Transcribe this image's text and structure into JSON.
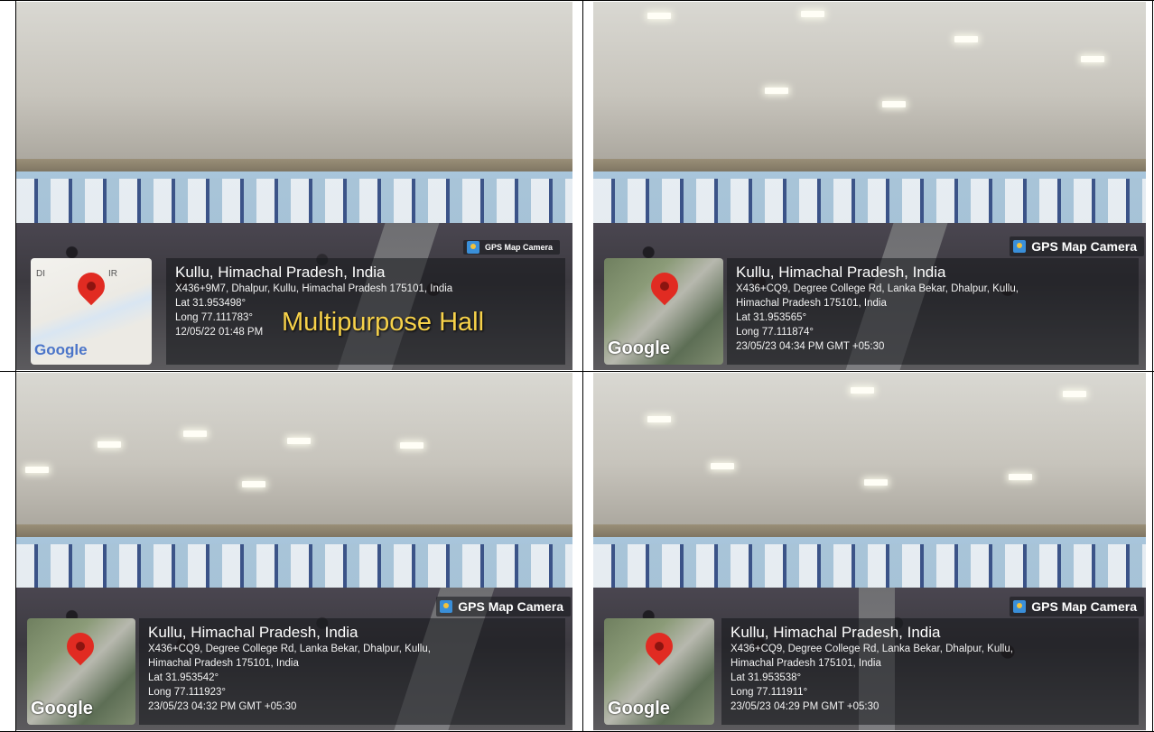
{
  "photos": [
    {
      "badge": "GPS Map Camera",
      "title": "Kullu, Himachal Pradesh, India",
      "address": "X436+9M7, Dhalpur, Kullu, Himachal Pradesh 175101, India",
      "lat": "Lat 31.953498°",
      "long": "Long 77.111783°",
      "timestamp": "12/05/22 01:48 PM",
      "caption": "Multipurpose Hall",
      "map_label": "DI",
      "map_label2": "IR",
      "google": "Google",
      "map_style": "roadmap"
    },
    {
      "badge": "GPS Map Camera",
      "title": "Kullu, Himachal Pradesh, India",
      "address": "X436+CQ9, Degree College Rd, Lanka Bekar, Dhalpur, Kullu,",
      "address2": "Himachal Pradesh 175101, India",
      "lat": "Lat 31.953565°",
      "long": "Long 77.111874°",
      "timestamp": "23/05/23 04:34 PM GMT +05:30",
      "google": "Google",
      "map_style": "satellite"
    },
    {
      "badge": "GPS Map Camera",
      "title": "Kullu, Himachal Pradesh, India",
      "address": "X436+CQ9, Degree College Rd, Lanka Bekar, Dhalpur, Kullu,",
      "address2": "Himachal Pradesh 175101, India",
      "lat": "Lat 31.953542°",
      "long": "Long 77.111923°",
      "timestamp": "23/05/23 04:32 PM GMT +05:30",
      "google": "Google",
      "map_style": "satellite"
    },
    {
      "badge": "GPS Map Camera",
      "title": "Kullu, Himachal Pradesh, India",
      "address": "X436+CQ9, Degree College Rd, Lanka Bekar, Dhalpur, Kullu,",
      "address2": "Himachal Pradesh 175101, India",
      "lat": "Lat 31.953538°",
      "long": "Long 77.111911°",
      "timestamp": "23/05/23 04:29 PM GMT +05:30",
      "google": "Google",
      "map_style": "satellite"
    }
  ]
}
